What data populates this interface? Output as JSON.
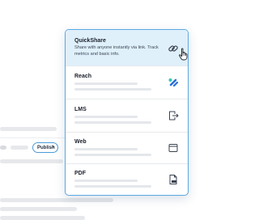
{
  "publish_button": {
    "label": "Publish",
    "chevron": "›"
  },
  "menu": {
    "items": [
      {
        "title": "QuickShare",
        "description": "Share with anyone instantly via link. Track metrics and basic info.",
        "icon": "link-icon",
        "active": true
      },
      {
        "title": "Reach",
        "icon": "reach-logo-icon"
      },
      {
        "title": "LMS",
        "icon": "export-file-icon"
      },
      {
        "title": "Web",
        "icon": "browser-window-icon"
      },
      {
        "title": "PDF",
        "icon": "pdf-file-icon"
      }
    ]
  },
  "colors": {
    "accent": "#4a9bd9",
    "active_item_bg": "#dff0fb",
    "reach_teal": "#2ec5b8",
    "reach_blue": "#2a6fd6"
  }
}
